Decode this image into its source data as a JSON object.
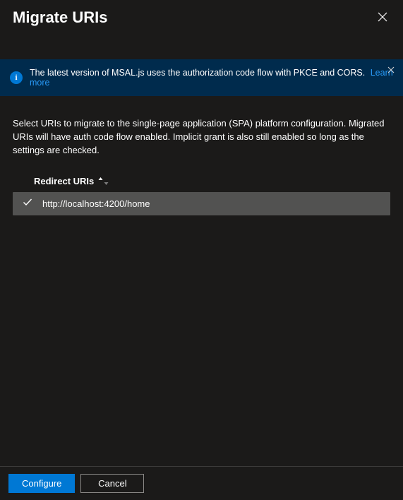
{
  "header": {
    "title": "Migrate URIs"
  },
  "banner": {
    "text": "The latest version of MSAL.js uses the authorization code flow with PKCE and CORS.",
    "link_label": "Learn more"
  },
  "description": "Select URIs to migrate to the single-page application (SPA) platform configuration. Migrated URIs will have auth code flow enabled. Implicit grant is also still enabled so long as the settings are checked.",
  "table": {
    "column_label": "Redirect URIs",
    "rows": [
      {
        "uri": "http://localhost:4200/home",
        "selected": true
      }
    ]
  },
  "footer": {
    "configure_label": "Configure",
    "cancel_label": "Cancel"
  }
}
